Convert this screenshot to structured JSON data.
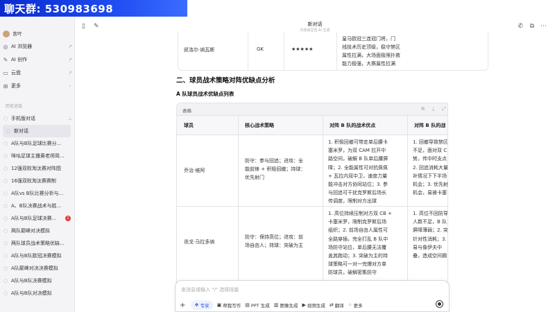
{
  "banner": {
    "text": "聊天群: 530983698"
  },
  "sidebar": {
    "user": {
      "name": "言叶"
    },
    "nav": [
      {
        "icon": "browser-icon",
        "label": "AI 浏览器",
        "arrow": "↗"
      },
      {
        "icon": "pen-icon",
        "label": "AI 创作",
        "arrow": "↗"
      },
      {
        "icon": "cloud-icon",
        "label": "云盘",
        "arrow": "↗"
      },
      {
        "icon": "grid-icon",
        "label": "更多",
        "arrow": "›"
      }
    ],
    "history_title": "历史对话",
    "history": [
      {
        "label": "手机版对话",
        "pinned": true
      },
      {
        "label": "新对话",
        "active": true
      },
      {
        "label": "A队与B队足球比赛分..."
      },
      {
        "label": "咪咕足球主播黄老师简..."
      },
      {
        "label": "12强双败淘汰赛对阵图"
      },
      {
        "label": "16强双败淘汰赛赛制"
      },
      {
        "label": "A队vs B队比赛分析与..."
      },
      {
        "label": "A、B队决赛战术与胜..."
      },
      {
        "label": "A队与B队足球决赛...",
        "badge": "1"
      },
      {
        "label": "两队巅峰对决模拟"
      },
      {
        "label": "两队球员战术策略优缺..."
      },
      {
        "label": "A队与B队欧冠决赛模拟"
      },
      {
        "label": "A队巅峰对决决赛模拟"
      },
      {
        "label": "A队与B队决赛模拟"
      },
      {
        "label": "A队与B队对决模拟"
      }
    ]
  },
  "header": {
    "title": "新对话",
    "subtitle": "内容由豆包 AI 生成"
  },
  "prev_row": {
    "player": "凯洛尔·纳瓦斯",
    "position": "GK",
    "rating": "★★★★★",
    "desc_lines": [
      "皇马欧冠三连冠门将，门",
      "线技术历史顶级，稳守禁区",
      "属性拉满，大场面极限扑救",
      "能力极强，大赛属性拉满"
    ]
  },
  "section_title": "二、球员战术策略对阵优缺点分析",
  "subsection_title": "A 队球员战术优缺点列表",
  "table": {
    "label": "表格",
    "columns": [
      "球员",
      "核心战术策略",
      "对阵 B 队的战术优点",
      "对阵 B 队的战"
    ],
    "rows": [
      {
        "player": "乔治·维阿",
        "strategy_lines": [
          "防守：参与回追；进攻：全",
          "能前锋 + 积极回撤；持球：",
          "优先射门"
        ],
        "pros_lines": [
          "1. 积极回撤可带走单后腰卡",
          "塞米罗，为双 CAM 拉开中",
          "路空间，破解 B 队单后腰屏",
          "障；2. 全能属性可对抗佩佩",
          "+ 瓦拉内双中卫，速度力量",
          "能冲击对方协同站位；3. 参",
          "与回追可干扰克罗斯后场长",
          "传调度，限制对方出球"
        ],
        "cons_lines": [
          "1. 回撤导致禁区",
          "不足，面对双 C",
          "势，传中时支点",
          "2. 回追消耗大量",
          "补情况下下半场",
          "机会；3. 优先射",
          "机会，易被卡塞"
        ]
      },
      {
        "player": "迭戈·马拉多纳",
        "strategy_lines": [
          "防守：保持高位；进攻：前",
          "场自由人；持球：突破为主"
        ],
        "pros_lines": [
          "1. 高位持续压制对方双 CB +",
          "卡塞米罗，限制克罗斯后场",
          "组织；2. 前场自由人属性可",
          "全路穿插，完全打乱 B 队中",
          "场防守站位，单后腰无法覆",
          "盖其跑动；3. 突破为主的持",
          "球策略可一对一完爆对方单",
          "防球员，破解密集防守"
        ],
        "cons_lines": [
          "1. 高位不回防导",
          "人数不足，B 队",
          "屏障薄弱；2. 突",
          "针对性消耗；3.",
          "易与像伊夫中",
          "叠，造成空间拥"
        ]
      }
    ]
  },
  "input": {
    "placeholder": "发消息或输入 \"/\" 选择技能",
    "tools": [
      {
        "icon": "expert-icon",
        "label": "专家"
      },
      {
        "icon": "write-icon",
        "label": "帮我写作"
      },
      {
        "icon": "ppt-icon",
        "label": "PPT 生成"
      },
      {
        "icon": "image-icon",
        "label": "图像生成"
      },
      {
        "icon": "video-icon",
        "label": "视频生成"
      },
      {
        "icon": "translate-icon",
        "label": "翻译"
      },
      {
        "icon": "more-icon",
        "label": "更多"
      }
    ]
  }
}
